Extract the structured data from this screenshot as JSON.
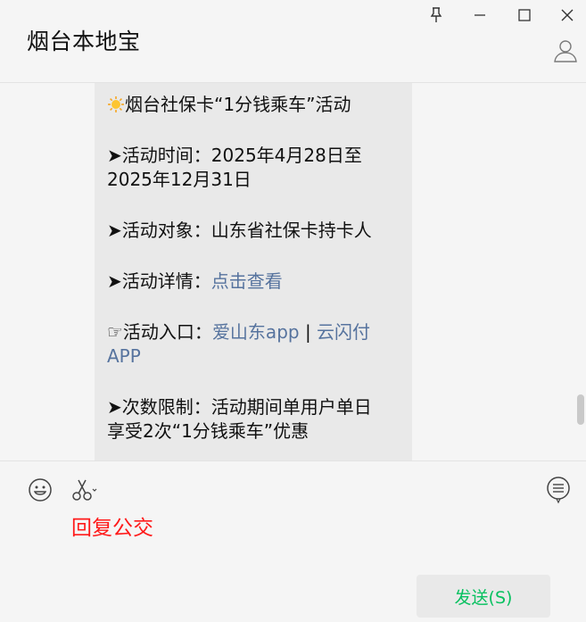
{
  "header": {
    "title": "烟台本地宝"
  },
  "message": {
    "line_title": "烟台社保卡“1分钱乘车”活动",
    "time_label": "➤活动时间：",
    "time_value": "2025年4月28日至",
    "time_value2": "2025年12月31日",
    "target_label": "➤活动对象：",
    "target_value": "山东省社保卡持卡人",
    "detail_label": "➤活动详情：",
    "detail_link": "点击查看",
    "entry_label": "☞活动入口：",
    "entry_link1": "爱山东app",
    "entry_sep": " | ",
    "entry_link2a": "云闪付",
    "entry_link2b": "APP",
    "limit_label": "➤次数限制：",
    "limit_value": "活动期间单用户单日",
    "limit_value2": "享受2次“1分钱乘车”优惠"
  },
  "input": {
    "draft_text": "回复公交"
  },
  "send_button": {
    "label": "发送(S)"
  },
  "colors": {
    "link": "#56739e",
    "send_text": "#07c160",
    "draft_text": "#ff1a1a"
  }
}
